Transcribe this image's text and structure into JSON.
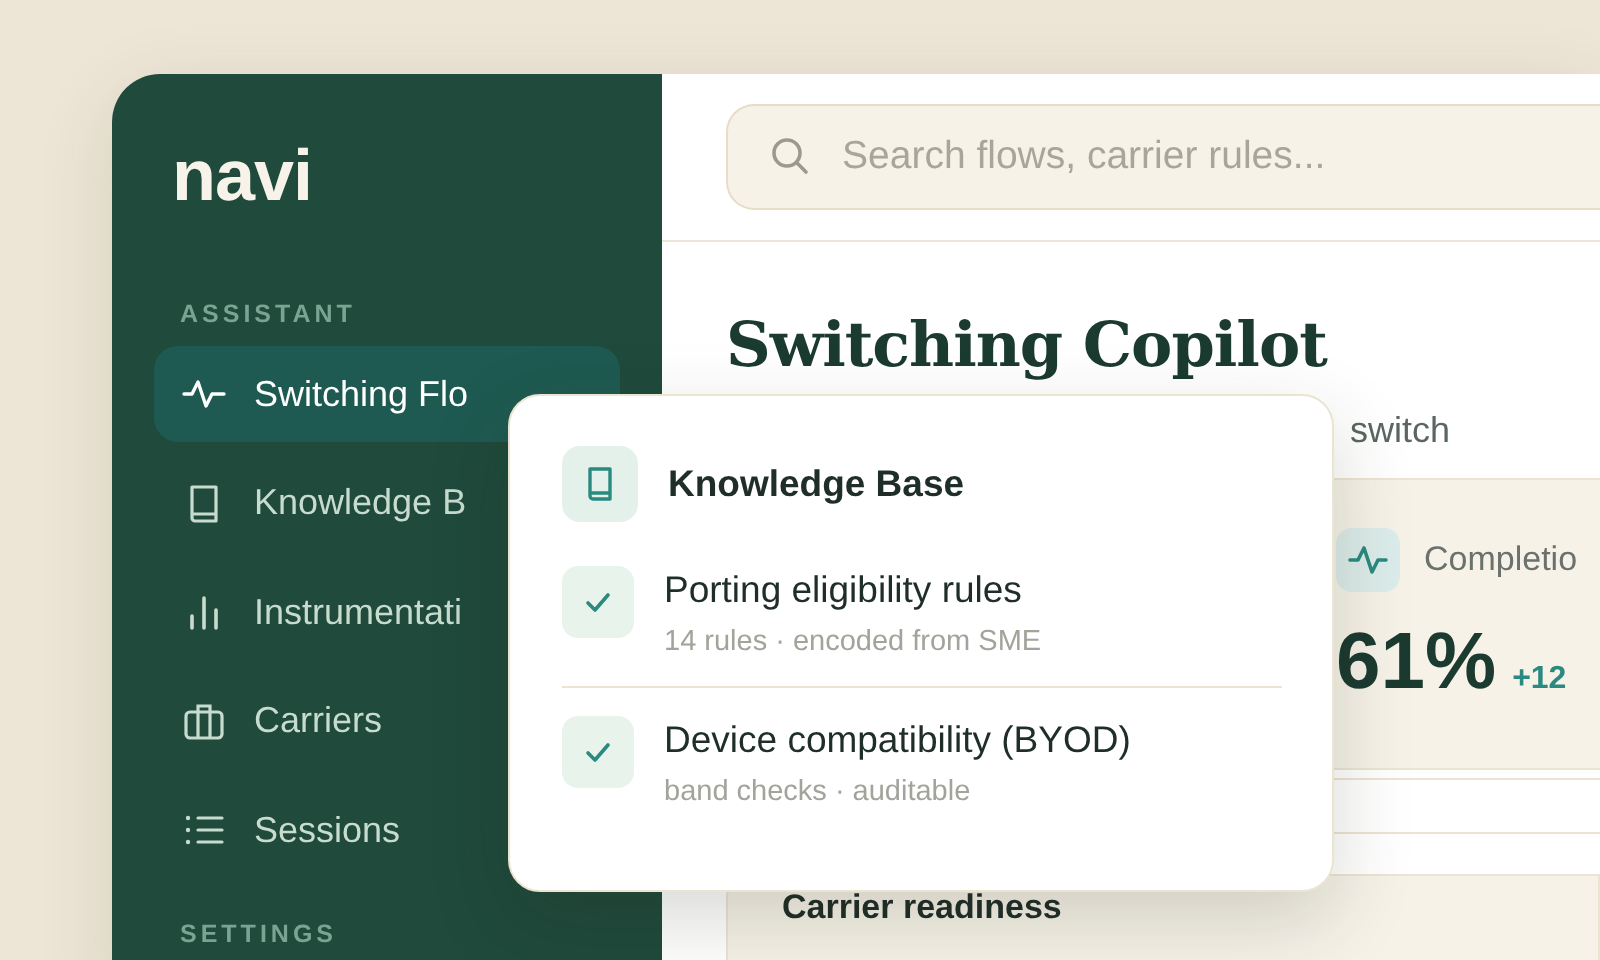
{
  "logo": "navi",
  "sidebar": {
    "section_label": "ASSISTANT",
    "items": [
      {
        "label": "Switching Flo",
        "selected": true
      },
      {
        "label": "Knowledge B",
        "selected": false
      },
      {
        "label": "Instrumentati",
        "selected": false
      },
      {
        "label": "Carriers",
        "selected": false
      },
      {
        "label": "Sessions",
        "selected": false
      }
    ],
    "section_label_2": "SETTINGS"
  },
  "search": {
    "placeholder": "Search flows, carrier rules..."
  },
  "page": {
    "title": "Switching Copilot",
    "subtitle": "switch"
  },
  "stat": {
    "label": "Completio",
    "value": "61%",
    "delta": "+12"
  },
  "card": {
    "title": "Carrier readiness"
  },
  "popover": {
    "title": "Knowledge Base",
    "items": [
      {
        "title": "Porting eligibility rules",
        "detail": "14 rules · encoded from SME",
        "checked": true
      },
      {
        "title": "Device compatibility (BYOD)",
        "detail": "band checks · auditable",
        "checked": true
      }
    ]
  }
}
